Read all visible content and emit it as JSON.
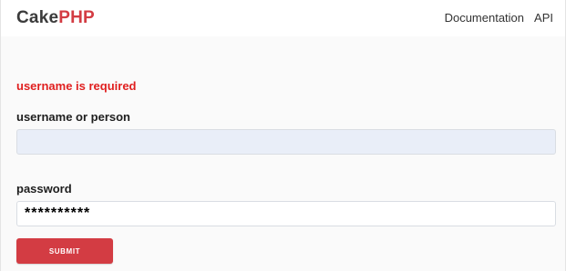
{
  "header": {
    "brand_cake": "Cake",
    "brand_php": "PHP",
    "nav": [
      "Documentation",
      "API"
    ]
  },
  "form": {
    "error": "username is required",
    "username_label": "username or person",
    "username_value": "",
    "password_label": "password",
    "password_value": "**********",
    "submit_label": "SUBMIT"
  },
  "colors": {
    "accent": "#d33c43",
    "error": "#e01f1f",
    "input_fill": "#e9eef8"
  }
}
